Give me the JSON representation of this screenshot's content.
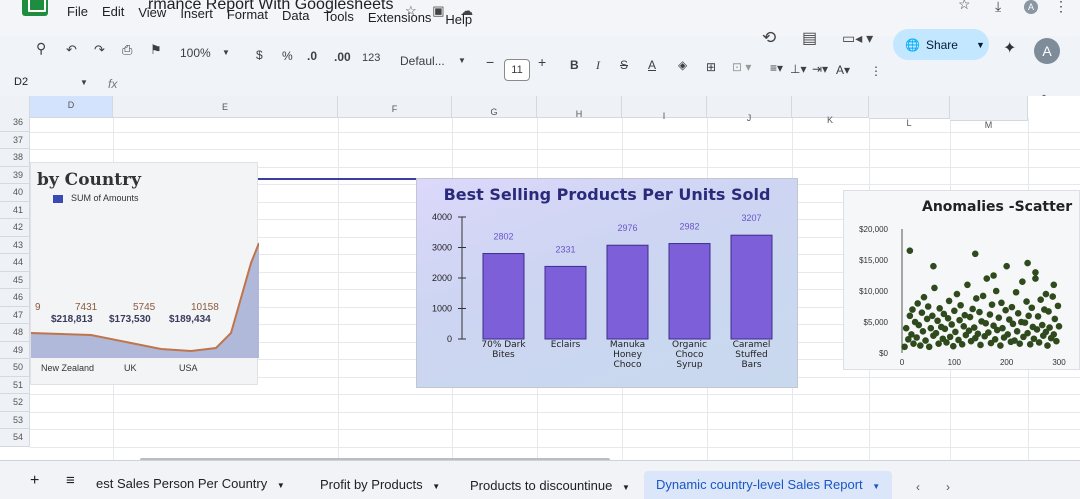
{
  "app": {
    "doc_title": "rmance Report With Googlesheets",
    "menu": [
      "File",
      "Edit",
      "View",
      "Insert",
      "Format",
      "Data",
      "Tools",
      "Extensions",
      "Help"
    ],
    "share_label": "Share",
    "avatar_letter": "A",
    "top_avatar_letter": "A"
  },
  "toolbar": {
    "zoom": "100%",
    "currency": "$",
    "percent": "%",
    "dec_decrease": ".0",
    "dec_increase": ".00",
    "number_format": "123",
    "font": "Defaul...",
    "font_size": "11",
    "bold": "B",
    "italic": "I",
    "strike": "S",
    "text_color": "A"
  },
  "formula_bar": {
    "name_box": "D2",
    "fx": "fx"
  },
  "grid": {
    "columns": [
      "D",
      "E",
      "F",
      "G",
      "H",
      "I",
      "J",
      "K",
      "L",
      "M"
    ],
    "rows": [
      "36",
      "37",
      "38",
      "39",
      "40",
      "41",
      "42",
      "43",
      "44",
      "45",
      "46",
      "47",
      "48",
      "49",
      "50",
      "51",
      "52",
      "53",
      "54"
    ]
  },
  "charts": {
    "country": {
      "title": "by Country",
      "legend": "SUM of Amounts",
      "legend_color": "#3b49b3",
      "line_color": "#c0744b",
      "fill_color": "#a9b3d6"
    },
    "best_selling": {
      "title": "Best Selling Products Per Units Sold",
      "bar_color": "#7d5fd9",
      "label_color": "#6a55c8"
    },
    "anomalies": {
      "title": "Anomalies -Scatter",
      "point_color": "#2f4a1c"
    }
  },
  "chart_data": [
    {
      "type": "area",
      "title": "by Country",
      "legend": "SUM of Amounts",
      "categories": [
        "New Zealand",
        "UK",
        "USA"
      ],
      "count_labels": [
        "9",
        "7431",
        "5745",
        "10158"
      ],
      "amount_labels": [
        "$218,813",
        "$173,530",
        "$189,434"
      ]
    },
    {
      "type": "bar",
      "title": "Best Selling Products Per Units Sold",
      "categories": [
        "70% Dark Bites",
        "Eclairs",
        "Manuka Honey Choco",
        "Organic Choco Syrup",
        "Caramel Stuffed Bars"
      ],
      "values": [
        2802,
        2331,
        2976,
        2982,
        3207
      ],
      "yticks": [
        "0",
        "1000",
        "2000",
        "3000",
        "4000"
      ],
      "ylim": [
        0,
        4000
      ]
    },
    {
      "type": "scatter",
      "title": "Anomalies -Scatter",
      "xticks": [
        "0",
        "100",
        "200",
        "300"
      ],
      "yticks": [
        "$0",
        "$5,000",
        "$10,000",
        "$15,000",
        "$20,000"
      ],
      "xlim": [
        0,
        300
      ],
      "ylim": [
        0,
        20000
      ],
      "points": [
        [
          5,
          1000
        ],
        [
          8,
          4000
        ],
        [
          12,
          2200
        ],
        [
          15,
          6000
        ],
        [
          18,
          3000
        ],
        [
          20,
          7000
        ],
        [
          22,
          1500
        ],
        [
          25,
          5000
        ],
        [
          28,
          2500
        ],
        [
          30,
          8000
        ],
        [
          32,
          4500
        ],
        [
          35,
          1200
        ],
        [
          38,
          6500
        ],
        [
          40,
          3500
        ],
        [
          42,
          9000
        ],
        [
          45,
          2000
        ],
        [
          48,
          5500
        ],
        [
          50,
          7500
        ],
        [
          52,
          1000
        ],
        [
          55,
          4000
        ],
        [
          58,
          6000
        ],
        [
          60,
          2800
        ],
        [
          62,
          10500
        ],
        [
          65,
          3200
        ],
        [
          68,
          5200
        ],
        [
          70,
          1500
        ],
        [
          72,
          7200
        ],
        [
          75,
          4200
        ],
        [
          78,
          2300
        ],
        [
          80,
          6300
        ],
        [
          82,
          3900
        ],
        [
          85,
          1700
        ],
        [
          88,
          5600
        ],
        [
          90,
          8400
        ],
        [
          92,
          2600
        ],
        [
          95,
          4600
        ],
        [
          98,
          1100
        ],
        [
          100,
          6800
        ],
        [
          102,
          3400
        ],
        [
          105,
          9500
        ],
        [
          108,
          2100
        ],
        [
          110,
          5300
        ],
        [
          112,
          7700
        ],
        [
          115,
          1400
        ],
        [
          118,
          4300
        ],
        [
          120,
          6100
        ],
        [
          122,
          2900
        ],
        [
          125,
          11000
        ],
        [
          128,
          3600
        ],
        [
          130,
          5800
        ],
        [
          132,
          1900
        ],
        [
          135,
          7100
        ],
        [
          138,
          4100
        ],
        [
          140,
          2400
        ],
        [
          142,
          8800
        ],
        [
          145,
          3100
        ],
        [
          148,
          6600
        ],
        [
          150,
          1300
        ],
        [
          152,
          5100
        ],
        [
          155,
          9200
        ],
        [
          158,
          2700
        ],
        [
          160,
          4800
        ],
        [
          162,
          12000
        ],
        [
          165,
          3300
        ],
        [
          168,
          6200
        ],
        [
          170,
          1600
        ],
        [
          172,
          7800
        ],
        [
          175,
          4400
        ],
        [
          178,
          2200
        ],
        [
          180,
          10000
        ],
        [
          182,
          3700
        ],
        [
          185,
          5700
        ],
        [
          188,
          1200
        ],
        [
          190,
          8100
        ],
        [
          192,
          4000
        ],
        [
          195,
          2500
        ],
        [
          198,
          6900
        ],
        [
          200,
          14000
        ],
        [
          202,
          3000
        ],
        [
          205,
          5400
        ],
        [
          208,
          1800
        ],
        [
          210,
          7400
        ],
        [
          212,
          4700
        ],
        [
          215,
          2000
        ],
        [
          218,
          9800
        ],
        [
          220,
          3500
        ],
        [
          222,
          6400
        ],
        [
          225,
          1500
        ],
        [
          228,
          5000
        ],
        [
          230,
          11500
        ],
        [
          232,
          2600
        ],
        [
          235,
          4900
        ],
        [
          238,
          8300
        ],
        [
          240,
          3200
        ],
        [
          242,
          6000
        ],
        [
          245,
          1400
        ],
        [
          248,
          7300
        ],
        [
          250,
          4200
        ],
        [
          252,
          2300
        ],
        [
          255,
          13000
        ],
        [
          258,
          3800
        ],
        [
          260,
          5900
        ],
        [
          262,
          1700
        ],
        [
          265,
          8600
        ],
        [
          268,
          4500
        ],
        [
          270,
          2800
        ],
        [
          272,
          7000
        ],
        [
          275,
          3400
        ],
        [
          278,
          1200
        ],
        [
          280,
          6700
        ],
        [
          282,
          4100
        ],
        [
          285,
          2400
        ],
        [
          288,
          9100
        ],
        [
          290,
          3000
        ],
        [
          292,
          5500
        ],
        [
          295,
          1900
        ],
        [
          298,
          7600
        ],
        [
          300,
          4300
        ],
        [
          15,
          16500
        ],
        [
          60,
          14000
        ],
        [
          140,
          16000
        ],
        [
          175,
          12500
        ],
        [
          240,
          14500
        ],
        [
          255,
          12000
        ],
        [
          275,
          9500
        ],
        [
          290,
          11000
        ]
      ]
    }
  ],
  "sheet_tabs": [
    "est Sales Person Per Country",
    "Profit by Products",
    "Products to discountinue",
    "Dynamic country-level Sales Report"
  ],
  "active_tab": "Dynamic country-level Sales Report"
}
